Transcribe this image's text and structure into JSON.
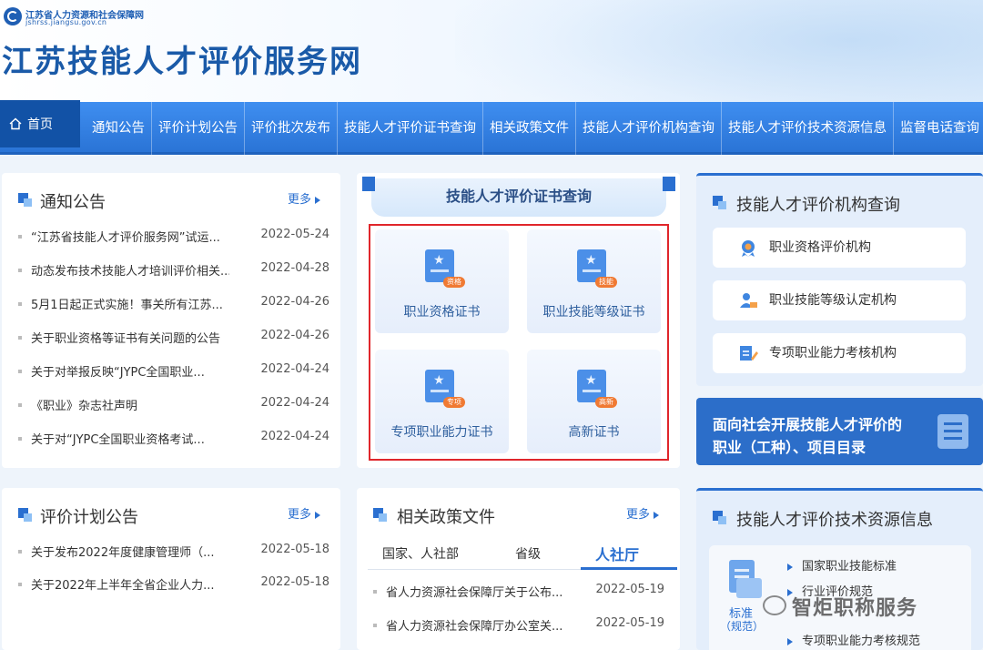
{
  "header": {
    "org_name": "江苏省人力资源和社会保障网",
    "org_url": "jshrss.jiangsu.gov.cn",
    "site_title": "江苏技能人才评价服务网"
  },
  "nav": {
    "home": "首页",
    "items": [
      "通知公告",
      "评价计划公告",
      "评价批次发布",
      "技能人才评价证书查询",
      "相关政策文件",
      "技能人才评价机构查询",
      "技能人才评价技术资源信息",
      "监督电话查询"
    ]
  },
  "notice": {
    "title": "通知公告",
    "more": "更多",
    "rows": [
      {
        "title": "“江苏省技能人才评价服务网”试运...",
        "date": "2022-05-24"
      },
      {
        "title": "动态发布技术技能人才培训评价相关...",
        "date": "2022-04-28"
      },
      {
        "title": "5月1日起正式实施！事关所有江苏...",
        "date": "2022-04-26"
      },
      {
        "title": "关于职业资格等证书有关问题的公告",
        "date": "2022-04-26"
      },
      {
        "title": "关于对举报反映“JYPC全国职业...",
        "date": "2022-04-24"
      },
      {
        "title": "《职业》杂志社声明",
        "date": "2022-04-24"
      },
      {
        "title": "关于对“JYPC全国职业资格考试...",
        "date": "2022-04-24"
      }
    ]
  },
  "cert": {
    "title": "技能人才评价证书查询",
    "tiles": [
      {
        "label": "职业资格证书",
        "tag": "资格"
      },
      {
        "label": "职业技能等级证书",
        "tag": "技能"
      },
      {
        "label": "专项职业能力证书",
        "tag": "专项"
      },
      {
        "label": "高新证书",
        "tag": "高新"
      }
    ]
  },
  "org_query": {
    "title": "技能人才评价机构查询",
    "items": [
      "职业资格评价机构",
      "职业技能等级认定机构",
      "专项职业能力考核机构"
    ]
  },
  "banner": {
    "line1": "面向社会开展技能人才评价的",
    "line2": "职业（工种）、项目目录"
  },
  "plan": {
    "title": "评价计划公告",
    "more": "更多",
    "rows": [
      {
        "title": "关于发布2022年度健康管理师（...",
        "date": "2022-05-18"
      },
      {
        "title": "关于2022年上半年全省企业人力...",
        "date": "2022-05-18"
      }
    ]
  },
  "policy": {
    "title": "相关政策文件",
    "more": "更多",
    "tabs": [
      "国家、人社部",
      "省级",
      "人社厅"
    ],
    "rows": [
      {
        "title": "省人力资源社会保障厅关于公布...",
        "date": "2022-05-19"
      },
      {
        "title": "省人力资源社会保障厅办公室关...",
        "date": "2022-05-19"
      }
    ]
  },
  "resource": {
    "title": "技能人才评价技术资源信息",
    "icon_label1": "标准",
    "icon_label2": "（规范）",
    "items": [
      "国家职业技能标准",
      "行业评价规范",
      "专项职业能力考核规范"
    ]
  },
  "watermark": "智炬职称服务"
}
